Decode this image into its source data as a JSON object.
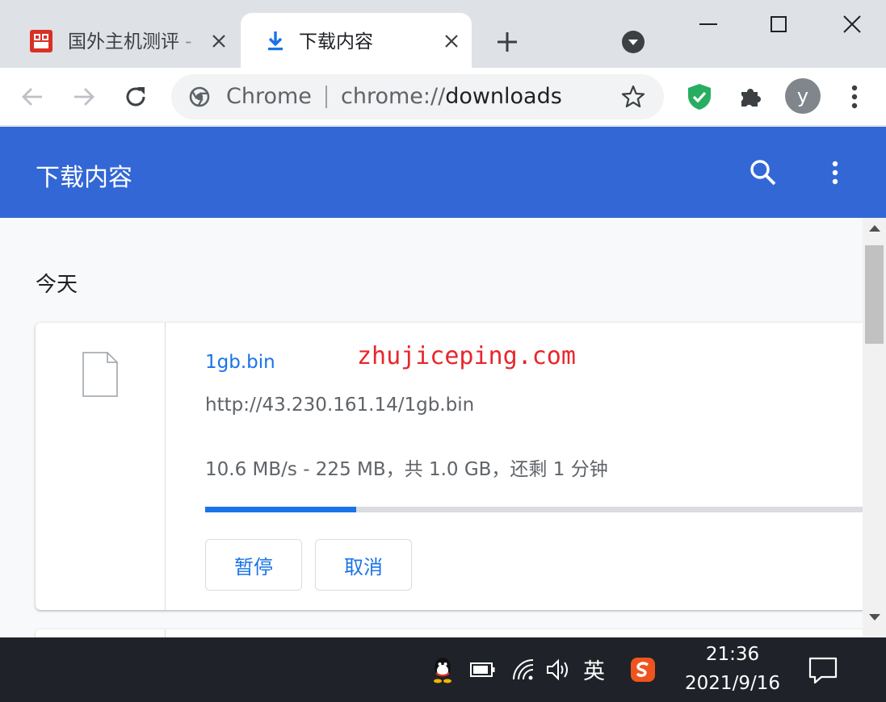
{
  "tabs": [
    {
      "title": "国外主机测评 - ",
      "active": false
    },
    {
      "title": "下载内容",
      "active": true
    }
  ],
  "omnibox": {
    "site_chip": "Chrome",
    "url_scheme": "chrome://",
    "url_rest": "downloads"
  },
  "profile": {
    "initial": "y"
  },
  "header": {
    "title": "下载内容"
  },
  "downloads": {
    "date_heading": "今天",
    "watermark": "zhujiceping.com",
    "items": [
      {
        "file_name": "1gb.bin",
        "url": "http://43.230.161.14/1gb.bin",
        "status": "10.6 MB/s - 225 MB，共 1.0 GB，还剩 1 分钟",
        "progress_fraction": 0.22,
        "pause_label": "暂停",
        "cancel_label": "取消"
      }
    ]
  },
  "taskbar": {
    "ime": "英",
    "time": "21:36",
    "date": "2021/9/16"
  },
  "colors": {
    "header_blue": "#3367d6",
    "link_blue": "#1a73e8",
    "tab_strip": "#dee1e6",
    "taskbar": "#1f2329",
    "watermark_red": "#e8262c"
  },
  "icons": [
    "tab-favicon",
    "download-icon",
    "close-icon",
    "plus-icon",
    "tab-search-icon",
    "minimize-icon",
    "maximize-icon",
    "close-window-icon",
    "back-arrow-icon",
    "forward-arrow-icon",
    "reload-icon",
    "chrome-icon",
    "star-icon",
    "shield-check-icon",
    "puzzle-icon",
    "kebab-menu-icon",
    "search-icon",
    "file-icon",
    "qq-icon",
    "battery-icon",
    "wifi-icon",
    "volume-icon",
    "sogou-icon",
    "notification-icon"
  ]
}
